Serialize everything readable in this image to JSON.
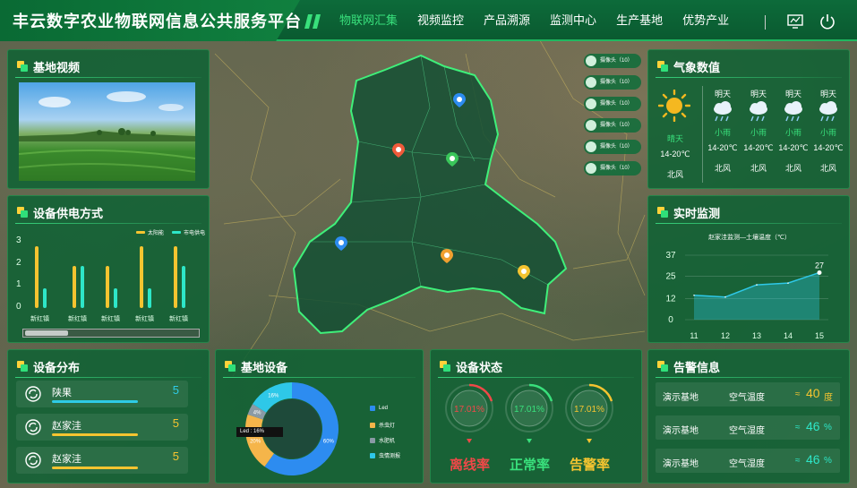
{
  "header": {
    "title": "丰云数字农业物联网信息公共服务平台",
    "nav": [
      "物联网汇集",
      "视频监控",
      "产品溯源",
      "监测中心",
      "生产基地",
      "优势产业"
    ],
    "active_nav": 0
  },
  "colors": {
    "accent": "#39e07c",
    "panel": "#10623a",
    "yellow": "#f5c430",
    "cyan": "#2ee6c8",
    "blue": "#2d8cf0",
    "red": "#f04848"
  },
  "video_panel": {
    "title": "基地视频"
  },
  "power_panel": {
    "title": "设备供电方式",
    "legend": [
      "太阳能",
      "市电供电"
    ]
  },
  "chart_data": [
    {
      "type": "bar",
      "title": "设备供电方式",
      "categories": [
        "新红镇",
        "新红镇",
        "新红镇",
        "新红镇",
        "新红镇"
      ],
      "series": [
        {
          "name": "太阳能",
          "values": [
            2.8,
            1.9,
            1.9,
            2.8,
            2.8
          ]
        },
        {
          "name": "市电供电",
          "values": [
            0.9,
            1.9,
            0.9,
            0.9,
            1.9
          ]
        }
      ],
      "yticks": [
        "0",
        "1",
        "2",
        "3"
      ],
      "ylim": [
        0,
        3
      ]
    },
    {
      "type": "area",
      "title": "赵家洼监测—土壤温度（℃）",
      "x": [
        "11",
        "12",
        "13",
        "14",
        "15"
      ],
      "values": [
        14,
        13,
        20,
        21,
        27
      ],
      "yticks": [
        "0",
        "12",
        "25",
        "37"
      ],
      "ylim": [
        0,
        37
      ],
      "annotation": "27"
    },
    {
      "type": "pie",
      "title": "基地设备",
      "labels": [
        "Led",
        "杀虫灯",
        "水肥机",
        "虫情测报"
      ],
      "values": [
        60,
        20,
        4,
        16
      ],
      "slice_labels": [
        "60%",
        "20%",
        "4%",
        "16%"
      ],
      "tooltip": "Led : 16%"
    }
  ],
  "map": {
    "cameras": [
      "摄像头（10）",
      "摄像头（10）",
      "摄像头（10）",
      "摄像头（10）",
      "摄像头（10）",
      "摄像头（10）"
    ]
  },
  "weather": {
    "title": "气象数值",
    "days": [
      {
        "day": "",
        "cond": "晴天",
        "temp": "14-20℃",
        "wind": "北风",
        "icon": "sun-icon"
      },
      {
        "day": "明天",
        "cond": "小雨",
        "temp": "14-20℃",
        "wind": "北风",
        "icon": "rain-icon"
      },
      {
        "day": "明天",
        "cond": "小雨",
        "temp": "14-20℃",
        "wind": "北风",
        "icon": "rain-icon"
      },
      {
        "day": "明天",
        "cond": "小雨",
        "temp": "14-20℃",
        "wind": "北风",
        "icon": "rain-icon"
      },
      {
        "day": "明天",
        "cond": "小雨",
        "temp": "14-20℃",
        "wind": "北风",
        "icon": "rain-icon"
      }
    ]
  },
  "realtime": {
    "title": "实时监测",
    "chart_title": "赵家洼监测—土壤温度（℃）"
  },
  "distribution": {
    "title": "设备分布",
    "rows": [
      {
        "name": "陕果",
        "count": "5",
        "color": "#2ecbe6"
      },
      {
        "name": "赵家洼",
        "count": "5",
        "color": "#f5c430"
      },
      {
        "name": "赵家洼",
        "count": "5",
        "color": "#f5c430"
      }
    ]
  },
  "base_devices": {
    "title": "基地设备"
  },
  "device_status": {
    "title": "设备状态",
    "rings": [
      {
        "value": "17.01%",
        "label": "离线率",
        "color": "#f04848"
      },
      {
        "value": "17.01%",
        "label": "正常率",
        "color": "#39e07c"
      },
      {
        "value": "17.01%",
        "label": "告警率",
        "color": "#f5c430"
      }
    ]
  },
  "alarm": {
    "title": "告警信息",
    "rows": [
      {
        "base": "演示基地",
        "metric": "空气温度",
        "dir": "≈",
        "value": "40",
        "unit": "度",
        "color": "#f5c430"
      },
      {
        "base": "演示基地",
        "metric": "空气湿度",
        "dir": "≈",
        "value": "46",
        "unit": "%",
        "color": "#2ee6c8"
      },
      {
        "base": "演示基地",
        "metric": "空气湿度",
        "dir": "≈",
        "value": "46",
        "unit": "%",
        "color": "#2ee6c8"
      }
    ]
  }
}
